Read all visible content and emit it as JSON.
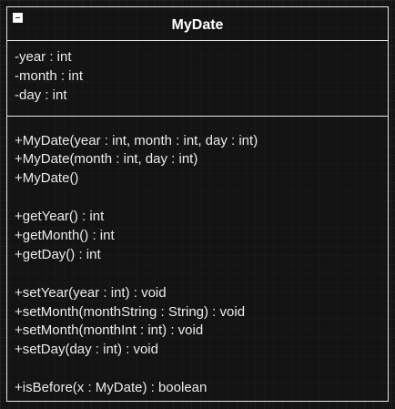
{
  "class": {
    "name": "MyDate",
    "attributes": [
      "-year : int",
      "-month : int",
      "-day : int"
    ],
    "methods": [
      "+MyDate(year : int, month : int, day : int)",
      "+MyDate(month : int, day : int)",
      "+MyDate()",
      "",
      "+getYear() : int",
      "+getMonth() : int",
      "+getDay() : int",
      "",
      "+setYear(year : int) : void",
      "+setMonth(monthString : String) : void",
      "+setMonth(monthInt : int) : void",
      "+setDay(day : int) : void",
      "",
      "+isBefore(x : MyDate) : boolean"
    ]
  },
  "colors": {
    "background": "#141414",
    "border": "#e8e8e8",
    "text": "#ececec"
  },
  "icons": {
    "collapse": "minus-square-icon"
  }
}
